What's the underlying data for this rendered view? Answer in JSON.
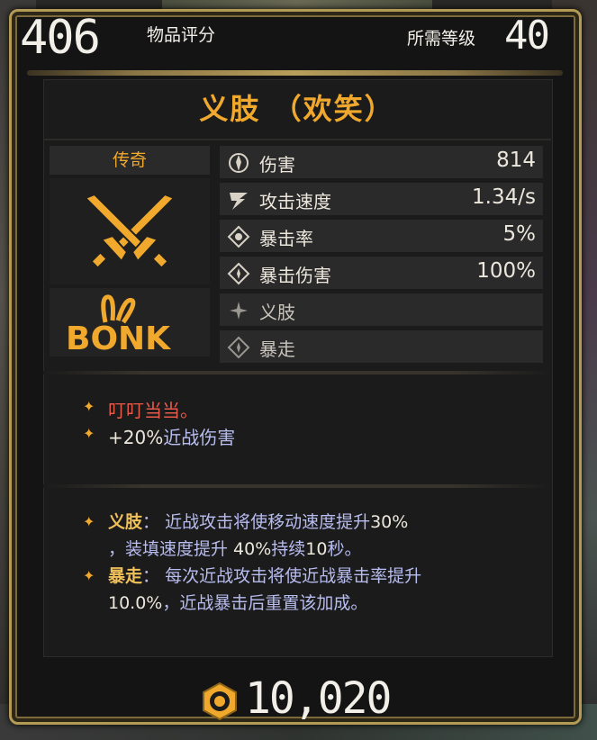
{
  "header": {
    "item_score": "406",
    "item_score_label": "物品评分",
    "required_level_label": "所需等级",
    "required_level": "40"
  },
  "item": {
    "name": "义肢 （欢笑）",
    "rarity": "传奇",
    "weapon_icon": "crossed-swords-icon",
    "brand_logo": "BONK"
  },
  "stats": [
    {
      "icon": "damage-icon",
      "label": "伤害",
      "value": "814"
    },
    {
      "icon": "attack-speed-icon",
      "label": "攻击速度",
      "value": "1.34/s"
    },
    {
      "icon": "crit-rate-icon",
      "label": "暴击率",
      "value": "5%"
    },
    {
      "icon": "crit-damage-icon",
      "label": "暴击伤害",
      "value": "100%"
    },
    {
      "icon": "prosthetic-icon",
      "label": "义肢",
      "value": ""
    },
    {
      "icon": "frenzy-icon",
      "label": "暴走",
      "value": ""
    }
  ],
  "effects": {
    "flavor": "叮叮当当。",
    "bonus_value": "+20%",
    "bonus_text": "近战伤害"
  },
  "passives": [
    {
      "name": "义肢",
      "sep": "：",
      "parts": [
        "近战攻击将使移动速度提升",
        "30%",
        "，装填速度提升 ",
        "40%",
        "持续",
        "10",
        "秒。"
      ]
    },
    {
      "name": "暴走",
      "sep": "：",
      "parts": [
        "每次近战攻击将使近战暴击率提升",
        "10.0%",
        "，近战暴击后重置该加成。"
      ]
    }
  ],
  "price": {
    "icon": "coin-icon",
    "value": "10,020"
  },
  "colors": {
    "accent_orange": "#f0a92c",
    "flavor_red": "#e8594a",
    "desc_blue": "#b8bdf0",
    "frame_gold": "#b39a55"
  }
}
